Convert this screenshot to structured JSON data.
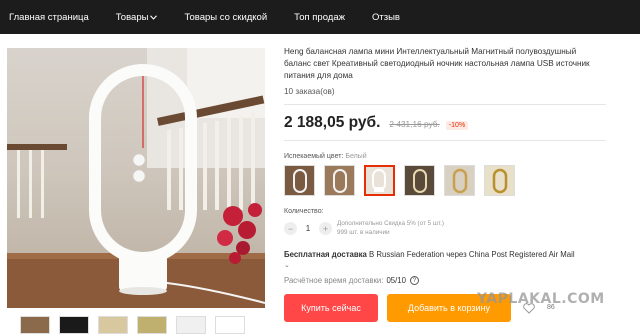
{
  "nav": {
    "items": [
      {
        "label": "Главная страница"
      },
      {
        "label": "Товары"
      },
      {
        "label": "Товары со скидкой"
      },
      {
        "label": "Топ продаж"
      },
      {
        "label": "Отзыв"
      }
    ]
  },
  "product": {
    "title": "Heng балансная лампа мини Интеллектуальный Магнитный полувоздушный баланс свет Креативный светодиодный ночник настольная лампа USB источник питания для дома",
    "orders": "10 заказа(ов)",
    "price": "2 188,05 руб.",
    "old_price": "2 431,16 руб.",
    "discount": "-10%"
  },
  "color": {
    "label": "Испекаемый цвет:",
    "selected": "Белый"
  },
  "quantity": {
    "label": "Количество:",
    "value": "1",
    "minus": "−",
    "plus": "+",
    "note_line1": "Дополнительно Скидка 5% (от 5 шт.)",
    "note_line2": "999 шт. в наличии"
  },
  "shipping": {
    "bold": "Бесплатная доставка",
    "rest": " В Russian Federation через China Post Registered Air Mail",
    "chevron": "⌄",
    "delivery_label": "Расчётное время доставки:",
    "delivery_value": "05/10",
    "help": "?"
  },
  "buttons": {
    "buy": "Купить сейчас",
    "cart": "Добавить в корзину"
  },
  "wishlist": {
    "count": "86"
  },
  "watermark": "YAPLAKAL.COM",
  "colors": {
    "accent": "#ff4747",
    "cart": "#ff9a00",
    "nav_bg": "#1c1c1c"
  }
}
